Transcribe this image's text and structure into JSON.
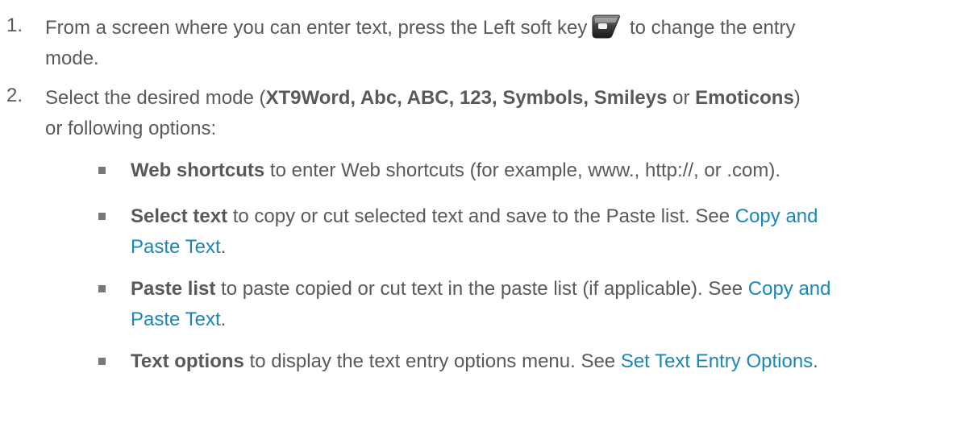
{
  "steps": [
    {
      "number": "1.",
      "line1_before_icon": "From a screen where you can enter text, press the Left soft key",
      "icon": "left-soft-key-icon",
      "line1_after_icon": " to change the entry",
      "line2": "mode."
    },
    {
      "number": "2.",
      "line1_prefix": "Select the desired mode (",
      "modes_bold": "XT9Word, Abc, ABC, 123, Symbols, Smileys",
      "or_text": " or ",
      "last_mode_bold": "Emoticons",
      "line1_suffix": ")",
      "line2": "or following options:"
    }
  ],
  "options": [
    {
      "term": "Web shortcuts",
      "text": " to enter Web shortcuts (for example, www., http://, or .com)."
    },
    {
      "term": "Select text",
      "text": " to copy or cut selected text and save to the Paste list. See ",
      "link_part1": "Copy and",
      "link_part2": "Paste Text",
      "end": "."
    },
    {
      "term": "Paste list",
      "text": " to paste copied or cut text in the paste list (if applicable). See ",
      "link_part1": "Copy and",
      "link_part2": "Paste Text",
      "end": "."
    },
    {
      "term": "Text options",
      "text": " to display the text entry options menu. See ",
      "link": "Set Text Entry Options",
      "end": "."
    }
  ],
  "colors": {
    "text": "#595959",
    "link": "#1b86b7",
    "bullet": "#777777"
  }
}
